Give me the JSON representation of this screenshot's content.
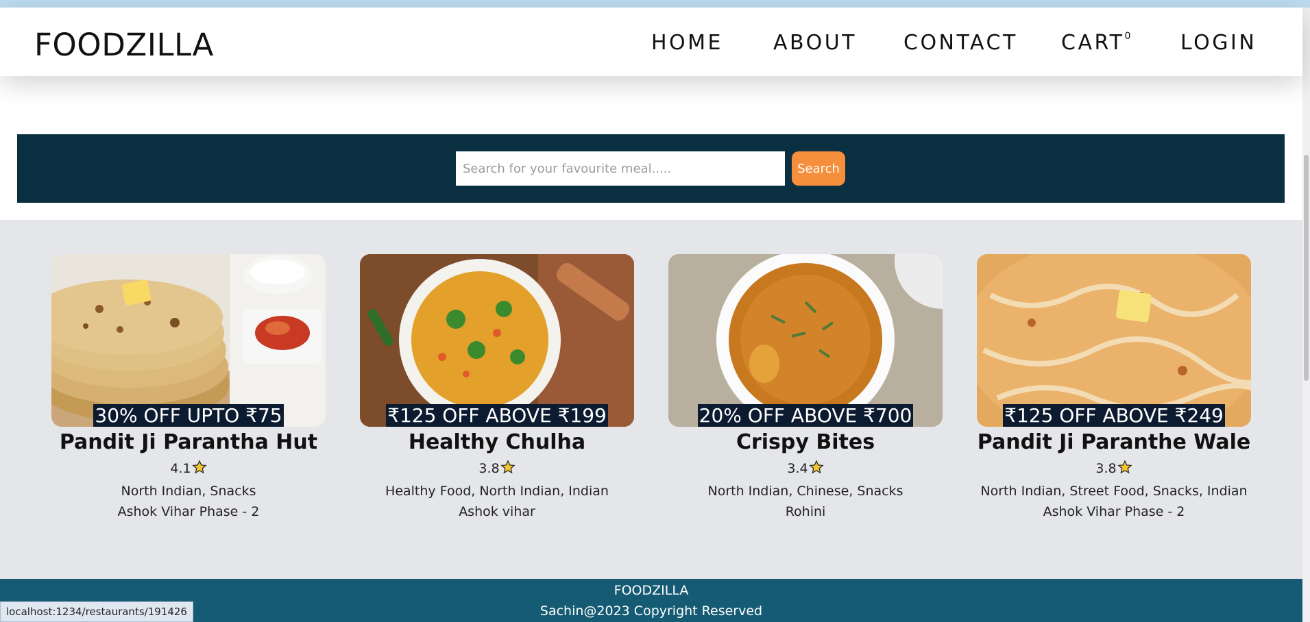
{
  "header": {
    "logo": "FOODZILLA",
    "nav": [
      {
        "label": "HOME"
      },
      {
        "label": "ABOUT"
      },
      {
        "label": "CONTACT"
      },
      {
        "label": "CART",
        "count": "0"
      },
      {
        "label": "LOGIN"
      }
    ]
  },
  "search": {
    "placeholder": "Search for your favourite meal.....",
    "value": "",
    "button_label": "Search"
  },
  "restaurants": [
    {
      "offer": "30% OFF UPTO ₹75",
      "name": "Pandit Ji Parantha Hut",
      "rating": "4.1",
      "cuisines": "North Indian, Snacks",
      "area": "Ashok Vihar Phase - 2"
    },
    {
      "offer": "₹125 OFF ABOVE ₹199",
      "name": "Healthy Chulha",
      "rating": "3.8",
      "cuisines": "Healthy Food, North Indian, Indian",
      "area": "Ashok vihar"
    },
    {
      "offer": "20% OFF ABOVE ₹700",
      "name": "Crispy Bites",
      "rating": "3.4",
      "cuisines": "North Indian, Chinese, Snacks",
      "area": "Rohini"
    },
    {
      "offer": "₹125 OFF ABOVE ₹249",
      "name": "Pandit Ji Paranthe Wale",
      "rating": "3.8",
      "cuisines": "North Indian, Street Food, Snacks, Indian",
      "area": "Ashok Vihar Phase - 2"
    }
  ],
  "footer": {
    "brand": "FOODZILLA",
    "copyright": "Sachin@2023 Copyright Reserved"
  },
  "statusbar": {
    "url": "localhost:1234/restaurants/191426"
  },
  "icons": {
    "star": "star-icon"
  },
  "colors": {
    "search_band": "#0a2f41",
    "search_button": "#f58f3c",
    "footer": "#155b73",
    "offer_bg": "#0c1b2f",
    "star": "#f5c431"
  }
}
